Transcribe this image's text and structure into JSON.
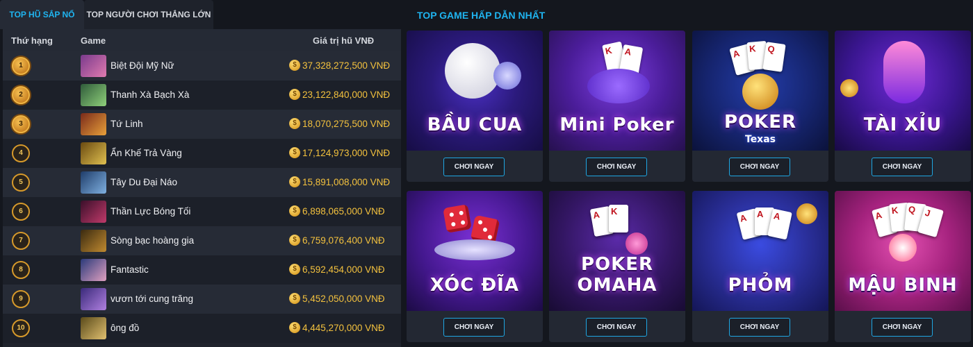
{
  "tabs": [
    {
      "label": "TOP HŨ SẮP NỔ",
      "active": true
    },
    {
      "label": "TOP NGƯỜI CHƠI THẮNG LỚN",
      "active": false
    }
  ],
  "table": {
    "headers": {
      "rank": "Thứ hạng",
      "game": "Game",
      "value": "Giá trị hũ VNĐ"
    },
    "rows": [
      {
        "rank": "1",
        "game": "Biệt Đội Mỹ Nữ",
        "value": "37,328,272,500 VNĐ"
      },
      {
        "rank": "2",
        "game": "Thanh Xà Bạch Xà",
        "value": "23,122,840,000 VNĐ"
      },
      {
        "rank": "3",
        "game": "Tứ Linh",
        "value": "18,070,275,500 VNĐ"
      },
      {
        "rank": "4",
        "game": "Ẩn Khế Trả Vàng",
        "value": "17,124,973,000 VNĐ"
      },
      {
        "rank": "5",
        "game": "Tây Du Đại Náo",
        "value": "15,891,008,000 VNĐ"
      },
      {
        "rank": "6",
        "game": "Thần Lực Bóng Tối",
        "value": "6,898,065,000 VNĐ"
      },
      {
        "rank": "7",
        "game": "Sòng bạc hoàng gia",
        "value": "6,759,076,400 VNĐ"
      },
      {
        "rank": "8",
        "game": "Fantastic",
        "value": "6,592,454,000 VNĐ"
      },
      {
        "rank": "9",
        "game": "vươn tới cung trăng",
        "value": "5,452,050,000 VNĐ"
      },
      {
        "rank": "10",
        "game": "ông đồ",
        "value": "4,445,270,000 VNĐ"
      }
    ]
  },
  "top_games": {
    "title": "TOP GAME HẤP DẪN NHẤT",
    "play_label": "CHƠI NGAY",
    "games": [
      {
        "title": "BẦU CUA",
        "subtitle": ""
      },
      {
        "title": "Mini Poker",
        "subtitle": ""
      },
      {
        "title": "POKER",
        "subtitle": "Texas"
      },
      {
        "title": "TÀI XỈU",
        "subtitle": ""
      },
      {
        "title": "XÓC ĐĨA",
        "subtitle": ""
      },
      {
        "title": "POKER OMAHA",
        "subtitle": ""
      },
      {
        "title": "PHỎM",
        "subtitle": ""
      },
      {
        "title": "MẬU BINH",
        "subtitle": ""
      }
    ]
  },
  "colors": {
    "accent": "#1fb4f0",
    "gold": "#f4c23e",
    "background": "#14171e"
  },
  "icons": {
    "coin": "coin-icon",
    "rank": "rank-medal-icon"
  }
}
